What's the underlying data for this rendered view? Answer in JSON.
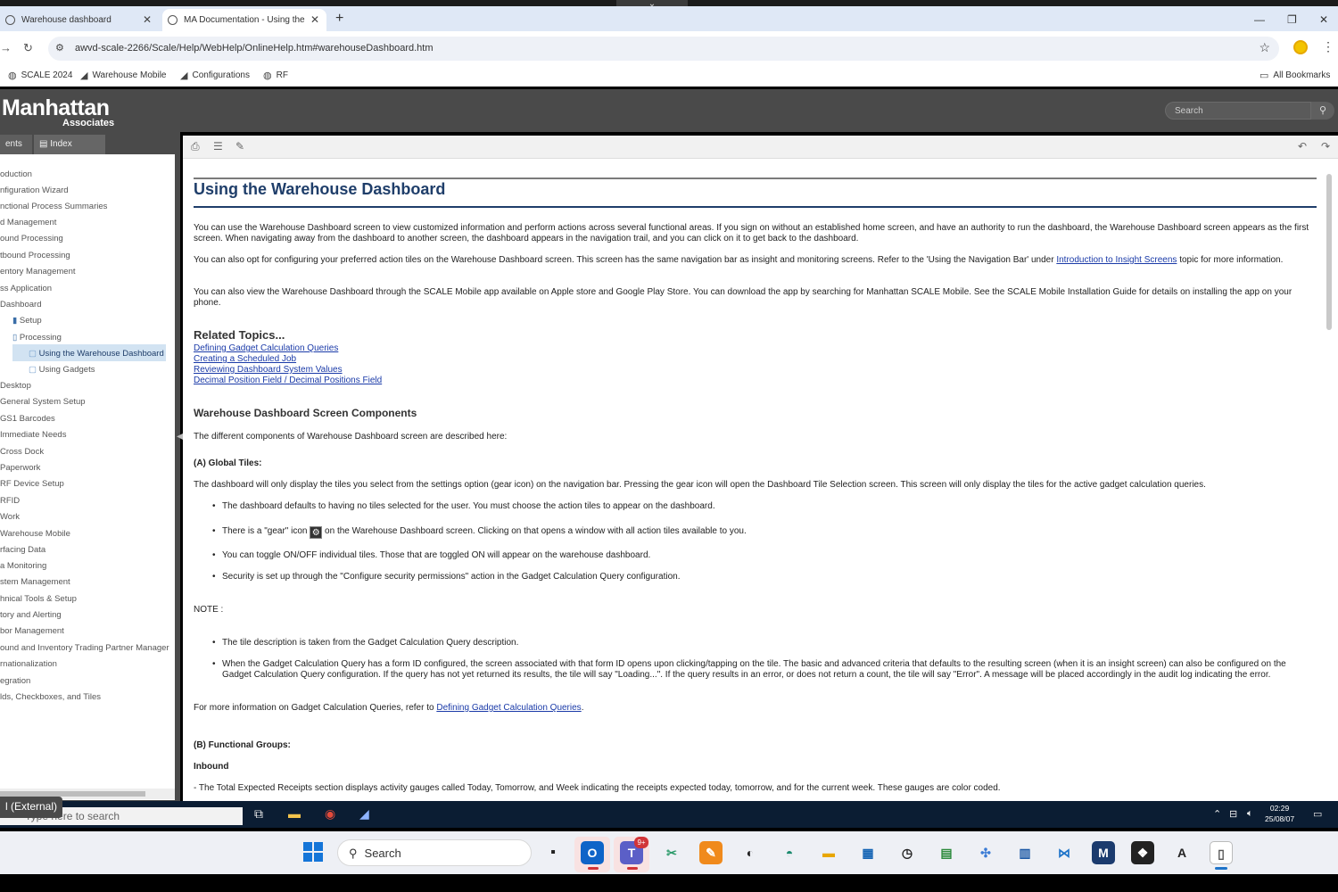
{
  "browser": {
    "tabs": [
      {
        "title": "Warehouse dashboard",
        "active": false
      },
      {
        "title": "MA Documentation - Using the",
        "active": true
      }
    ],
    "url": "awvd-scale-2266/Scale/Help/WebHelp/OnlineHelp.htm#warehouseDashboard.htm",
    "bookmarks": [
      "SCALE 2024",
      "Warehouse Mobile",
      "Configurations",
      "RF"
    ],
    "all_bookmarks": "All Bookmarks"
  },
  "help": {
    "logo_main": "Manhattan",
    "logo_sub": "Associates",
    "search_placeholder": "Search",
    "tabs": [
      "ents",
      "Index"
    ],
    "toc": [
      "oduction",
      "nfiguration Wizard",
      "nctional Process Summaries",
      "d Management",
      "ound Processing",
      "tbound Processing",
      "entory Management",
      "ss Application",
      " Dashboard",
      "Setup",
      "Processing",
      "Using the Warehouse Dashboard",
      "Using Gadgets",
      "Desktop",
      "General System Setup",
      "GS1 Barcodes",
      "Immediate Needs",
      "Cross Dock",
      "Paperwork",
      "RF Device Setup",
      "RFID",
      "Work",
      "Warehouse Mobile",
      "rfacing Data",
      "a Monitoring",
      "stem Management",
      "hnical Tools & Setup",
      "tory and Alerting",
      "bor Management",
      "ound and Inventory Trading Partner Manager",
      "rnationalization",
      "egration",
      "lds, Checkboxes, and Tiles"
    ]
  },
  "doc": {
    "title": "Using the Warehouse Dashboard",
    "p1": "You can use the Warehouse Dashboard screen to view customized information and perform actions across several functional areas. If you sign on without an established home screen, and have an authority to run the dashboard, the Warehouse Dashboard screen appears as the first screen. When navigating away from the dashboard to another screen, the dashboard appears in the navigation trail, and you can click on it to get back to the dashboard.",
    "p2a": "You can also opt for configuring your preferred action tiles on the Warehouse Dashboard screen. This screen has the same navigation bar as insight and monitoring screens. Refer to the 'Using the Navigation Bar' under ",
    "p2link": "Introduction to Insight Screens",
    "p2b": " topic for more information.",
    "p3": "You can also view the Warehouse Dashboard through the SCALE Mobile app available on Apple store and Google Play Store. You can download the app by searching for Manhattan SCALE Mobile. See the SCALE Mobile Installation Guide for details on installing the app on your phone.",
    "related_heading": "Related Topics...",
    "related": [
      "Defining Gadget Calculation Queries",
      "Creating a Scheduled Job",
      "Reviewing Dashboard System Values",
      "Decimal Position Field / Decimal Positions Field"
    ],
    "components_heading": "Warehouse Dashboard Screen Components",
    "components_intro": "The different components of Warehouse Dashboard screen are described here:",
    "global_tiles_heading": "(A) Global Tiles:",
    "global_tiles_text": "The dashboard will only display the tiles you select from the settings option (gear icon) on the navigation bar. Pressing the gear icon will open the Dashboard Tile Selection screen. This screen will only display the tiles for the active gadget calculation queries.",
    "bullets": [
      "The dashboard defaults to having no tiles selected for the user. You must choose the action tiles to appear on the dashboard.",
      "You can toggle ON/OFF individual tiles. Those that are toggled ON will appear on the warehouse dashboard.",
      "Security is set up through the \"Configure security permissions\" action in the Gadget Calculation Query configuration."
    ],
    "gear_bullet_a": "There is a \"gear\" icon ",
    "gear_bullet_b": " on the Warehouse Dashboard screen. Clicking on that opens a window with all action tiles available to you.",
    "note_label": "NOTE :",
    "note_bullets": [
      "The tile description is taken from the Gadget Calculation Query description.",
      "When the Gadget Calculation Query has a form ID configured, the screen associated with that form ID opens upon clicking/tapping on the tile. The basic and advanced criteria that defaults to the resulting screen (when it is an insight screen) can also be configured on the Gadget Calculation Query configuration. If the query has not yet returned its results, the tile will say \"Loading...\". If the query results in an error, or does not return a count, the tile will say \"Error\". A message will be placed accordingly in the audit log indicating the error."
    ],
    "more_info_a": "For more information on Gadget Calculation Queries, refer to ",
    "more_info_link": "Defining Gadget Calculation Queries",
    "more_info_b": ".",
    "functional_heading": "(B) Functional Groups:",
    "inbound_heading": "Inbound",
    "inbound_text": "- The Total Expected Receipts section displays activity gauges called Today, Tomorrow, and Week indicating the receipts expected today, tomorrow, and for the current week. These gauges are color coded."
  },
  "remote_taskbar": {
    "external_label": "l (External)",
    "search_text": "Type here to search",
    "time": "02:29",
    "date": "25/08/07"
  },
  "taskbar": {
    "search_label": "Search",
    "teams_badge": "9+"
  },
  "colors": {
    "title_blue": "#1f3e6a",
    "link_blue": "#1a3aa8",
    "header_gray": "#4a4a4a",
    "toc_selected": "#d2e3f2"
  }
}
